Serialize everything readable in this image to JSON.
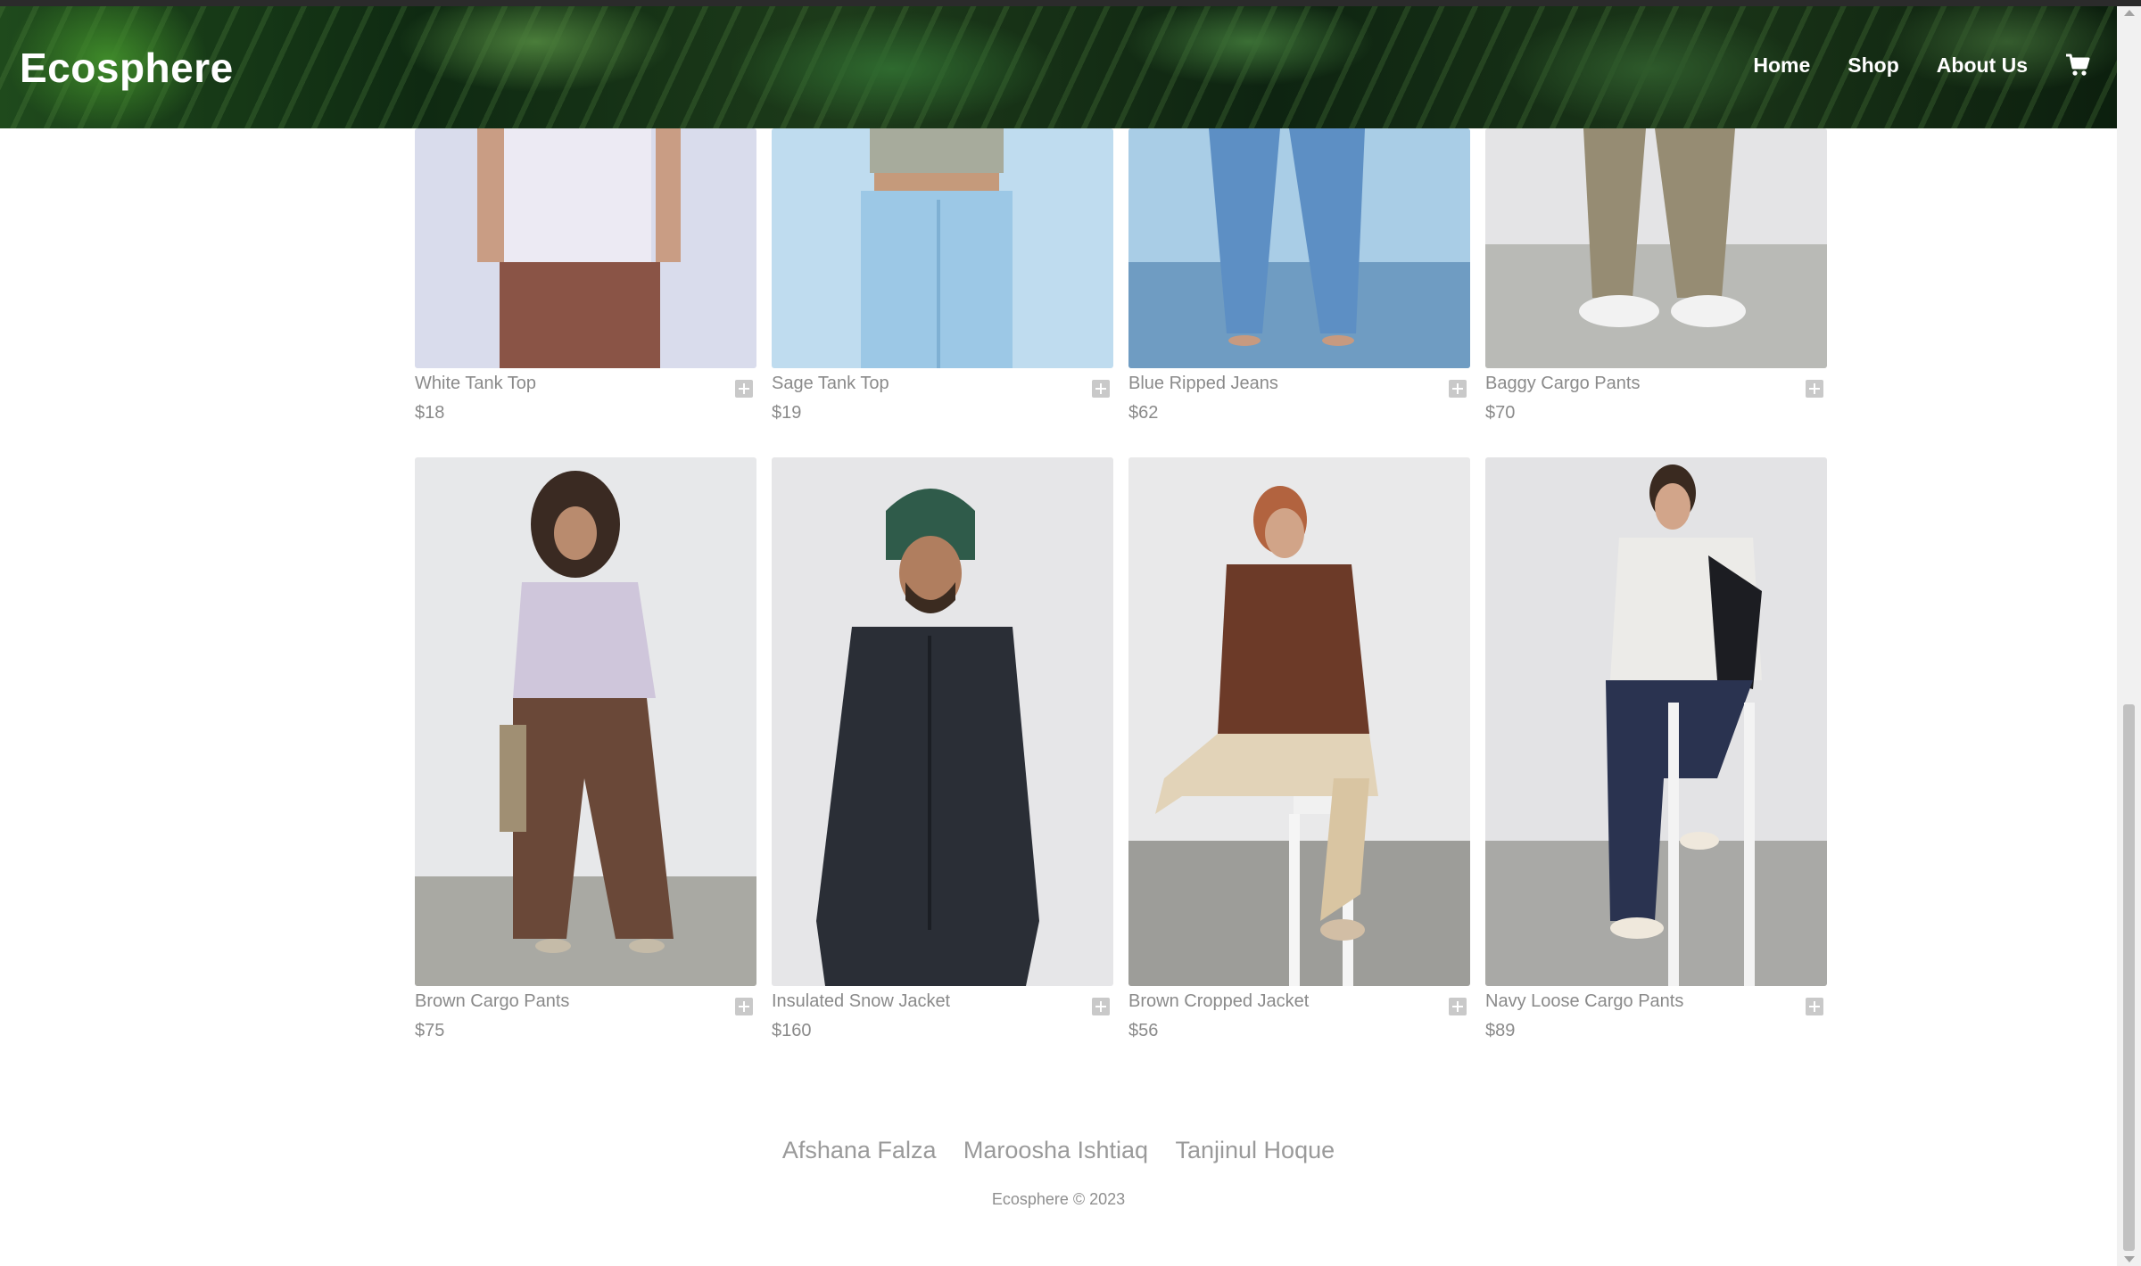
{
  "header": {
    "logo": "Ecosphere",
    "nav": [
      {
        "label": "Home"
      },
      {
        "label": "Shop"
      },
      {
        "label": "About Us"
      }
    ],
    "cart_icon": "cart-icon"
  },
  "products": [
    {
      "name": "White Tank Top",
      "price": "$18"
    },
    {
      "name": "Sage Tank Top",
      "price": "$19"
    },
    {
      "name": "Blue Ripped Jeans",
      "price": "$62"
    },
    {
      "name": "Baggy Cargo Pants",
      "price": "$70"
    },
    {
      "name": "Brown Cargo Pants",
      "price": "$75"
    },
    {
      "name": "Insulated Snow Jacket",
      "price": "$160"
    },
    {
      "name": "Brown Cropped Jacket",
      "price": "$56"
    },
    {
      "name": "Navy Loose Cargo Pants",
      "price": "$89"
    }
  ],
  "footer": {
    "names": [
      "Afshana Falza",
      "Maroosha Ishtiaq",
      "Tanjinul Hoque"
    ],
    "copyright": "Ecosphere © 2023"
  }
}
